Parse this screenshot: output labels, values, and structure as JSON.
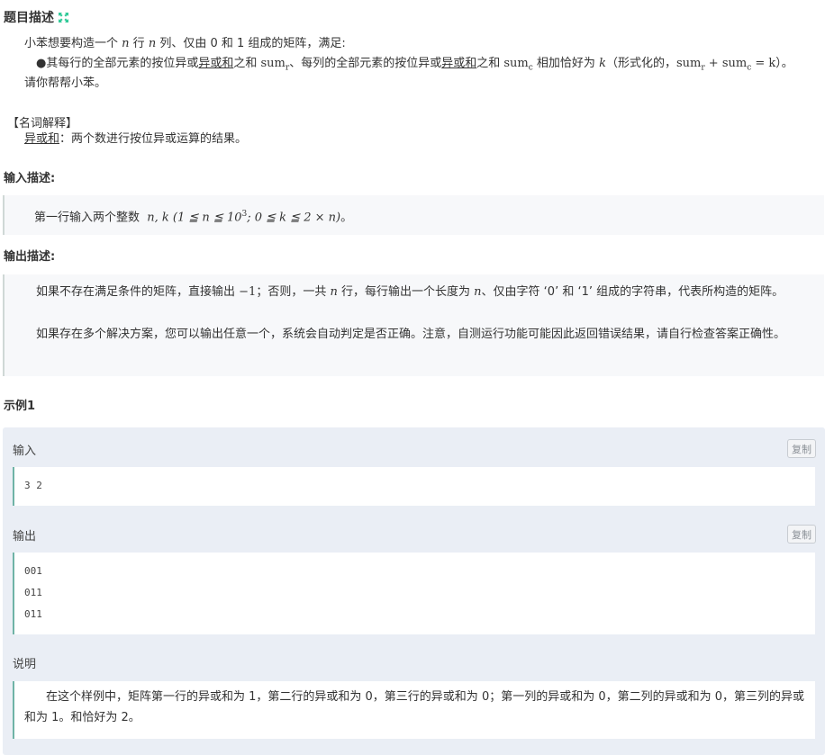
{
  "problem": {
    "title": "题目描述",
    "intro_a": "小苯想要构造一个",
    "intro_n1": "n",
    "intro_b": "行",
    "intro_n2": "n",
    "intro_c": "列、仅由 0 和 1 组成的矩阵，满足:",
    "bullet_a": "其每行的全部元素的按位异或",
    "bullet_link1": "异或和",
    "bullet_b": "之和 sum",
    "bullet_sub_r": "r",
    "bullet_c": "、每列的全部元素的按位异或",
    "bullet_link2": "异或和",
    "bullet_d": "之和 sum",
    "bullet_sub_c": "c",
    "bullet_e": " 相加恰好为",
    "bullet_k": "k",
    "bullet_f": "（形式化的，sum",
    "bullet_sub_r2": "r",
    "bullet_g": " + sum",
    "bullet_sub_c2": "c",
    "bullet_h": " = k）。",
    "ask": "请你帮帮小苯。"
  },
  "glossary": {
    "heading": "【名词解释】",
    "term": "异或和",
    "definition": "：两个数进行按位异或运算的结果。"
  },
  "input_desc": {
    "heading": "输入描述:",
    "text_a": "第一行输入两个整数",
    "formula": "n, k (1 ≦ n ≦ 10",
    "formula_sup": "3",
    "formula_b": "; 0 ≦ k ≦ 2 × n)",
    "text_end": "。"
  },
  "output_desc": {
    "heading": "输出描述:",
    "p1_a": "如果不存在满足条件的矩阵，直接输出",
    "p1_m1": "−1",
    "p1_b": "；否则，一共",
    "p1_n": "n",
    "p1_c": "行，每行输出一个长度为",
    "p1_n2": "n",
    "p1_d": "、仅由字符 ‘0’ 和 ‘1’ 组成的字符串，代表所构造的矩阵。",
    "p2": "如果存在多个解决方案，您可以输出任意一个，系统会自动判定是否正确。注意，自测运行功能可能因此返回错误结果，请自行检查答案正确性。"
  },
  "example": {
    "heading": "示例1",
    "input_label": "输入",
    "input_lines": [
      "3 2"
    ],
    "output_label": "输出",
    "output_lines": [
      "001",
      "011",
      "011"
    ],
    "copy_label": "复制",
    "expl_label": "说明",
    "expl_text": "在这个样例中，矩阵第一行的异或和为 1，第二行的异或和为 0，第三行的异或和为 0；第一列的异或和为 0，第二列的异或和为 0，第三列的异或和为 1。和恰好为 2。"
  },
  "colors": {
    "accent": "#32ca99",
    "code_border": "#6fb3a6"
  },
  "icons": {
    "title_icon": "expand-icon"
  }
}
